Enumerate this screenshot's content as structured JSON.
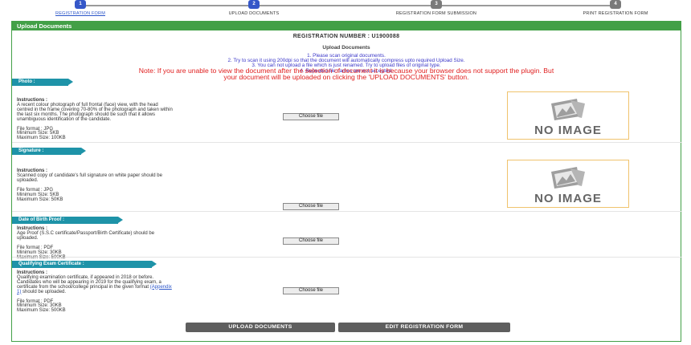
{
  "steps": [
    {
      "number": "1",
      "label": "REGISTRATION FORM"
    },
    {
      "number": "2",
      "label": "UPLOAD DOCUMENTS"
    },
    {
      "number": "3",
      "label": "REGISTRATION FORM SUBMISSION"
    },
    {
      "number": "4",
      "label": "PRINT REGISTRATION FORM"
    }
  ],
  "panel": {
    "title": "Upload Documents",
    "registration_number": "REGISTRATION NUMBER : U1900088",
    "subtitle": "Upload Documents",
    "notes": [
      "1. Please scan original documents.",
      "2. Try to scan it using 200dpi so that the document will automatically compress upto required Upload Size.",
      "3. You can not upload a file which is just renamed. Try to upload files of original type.",
      "4. Repeated file names are not accepted."
    ],
    "warning_line1": "Note: If you are unable to view the document after the selection of document it is because your browser does not support the plugin. But",
    "warning_line2": "your document will be uploaded on clicking the 'UPLOAD DOCUMENTS' button."
  },
  "sections": {
    "photo": {
      "title": "Photo :",
      "instructions_heading": "Instructions :",
      "instructions": [
        "A recent colour photograph of full frontal (face) view, with the head",
        "centred in the frame covering 70-80% of the photograph and taken within",
        "the last six months. The photograph should be such that it allows",
        "unambiguous identification of the candidate."
      ],
      "file_format": "File format : JPG",
      "min_size": "Minimum Size: 5KB",
      "max_size": "Maximum Size: 100KB",
      "button": "Choose file",
      "preview": "NO IMAGE"
    },
    "signature": {
      "title": "Signature :",
      "instructions_heading": "Instructions :",
      "instructions": [
        "Scanned copy of candidate's full signature on white paper should be",
        "uploaded."
      ],
      "file_format": "File format : JPG",
      "min_size": "Minimum Size: 5KB",
      "max_size": "Maximum Size: 50KB",
      "button": "Choose file",
      "preview": "NO IMAGE"
    },
    "dob": {
      "title": "Date of Birth Proof :",
      "instructions_heading": "Instructions :",
      "instructions": [
        "Age Proof (S.S.C certificate/Passport/Birth Certificate) should be",
        "uploaded."
      ],
      "file_format": "File format : PDF",
      "min_size": "Minimum Size: 30KB",
      "max_size": "Maximum Size: 500KB",
      "button": "Choose file"
    },
    "qualifying": {
      "title": "Qualifying Exam Certificate :",
      "instructions_heading": "Instructions :",
      "instructions": [
        "Qualifying examination certificate, if appeared in 2018 or before.",
        "Candidates who will be appearing in 2019 for the qualifying exam, a",
        "certificate from the school/college principal in the given format"
      ],
      "appendix_link": "(Appendix",
      "appendix_tail_link": "1)",
      "appendix_tail": " should be uploaded.",
      "file_format": "File format : PDF",
      "min_size": "Minimum Size: 30KB",
      "max_size": "Maximum Size: 500KB",
      "button": "Choose file"
    }
  },
  "actions": {
    "upload": "UPLOAD DOCUMENTS",
    "edit": "EDIT REGISTRATION FORM"
  },
  "colors": {
    "panel_green": "#43a047",
    "section_teal": "#1e93a8",
    "note_blue": "#3a36c8",
    "warning_red": "#e02020",
    "button_gray": "#5e5e5e"
  }
}
